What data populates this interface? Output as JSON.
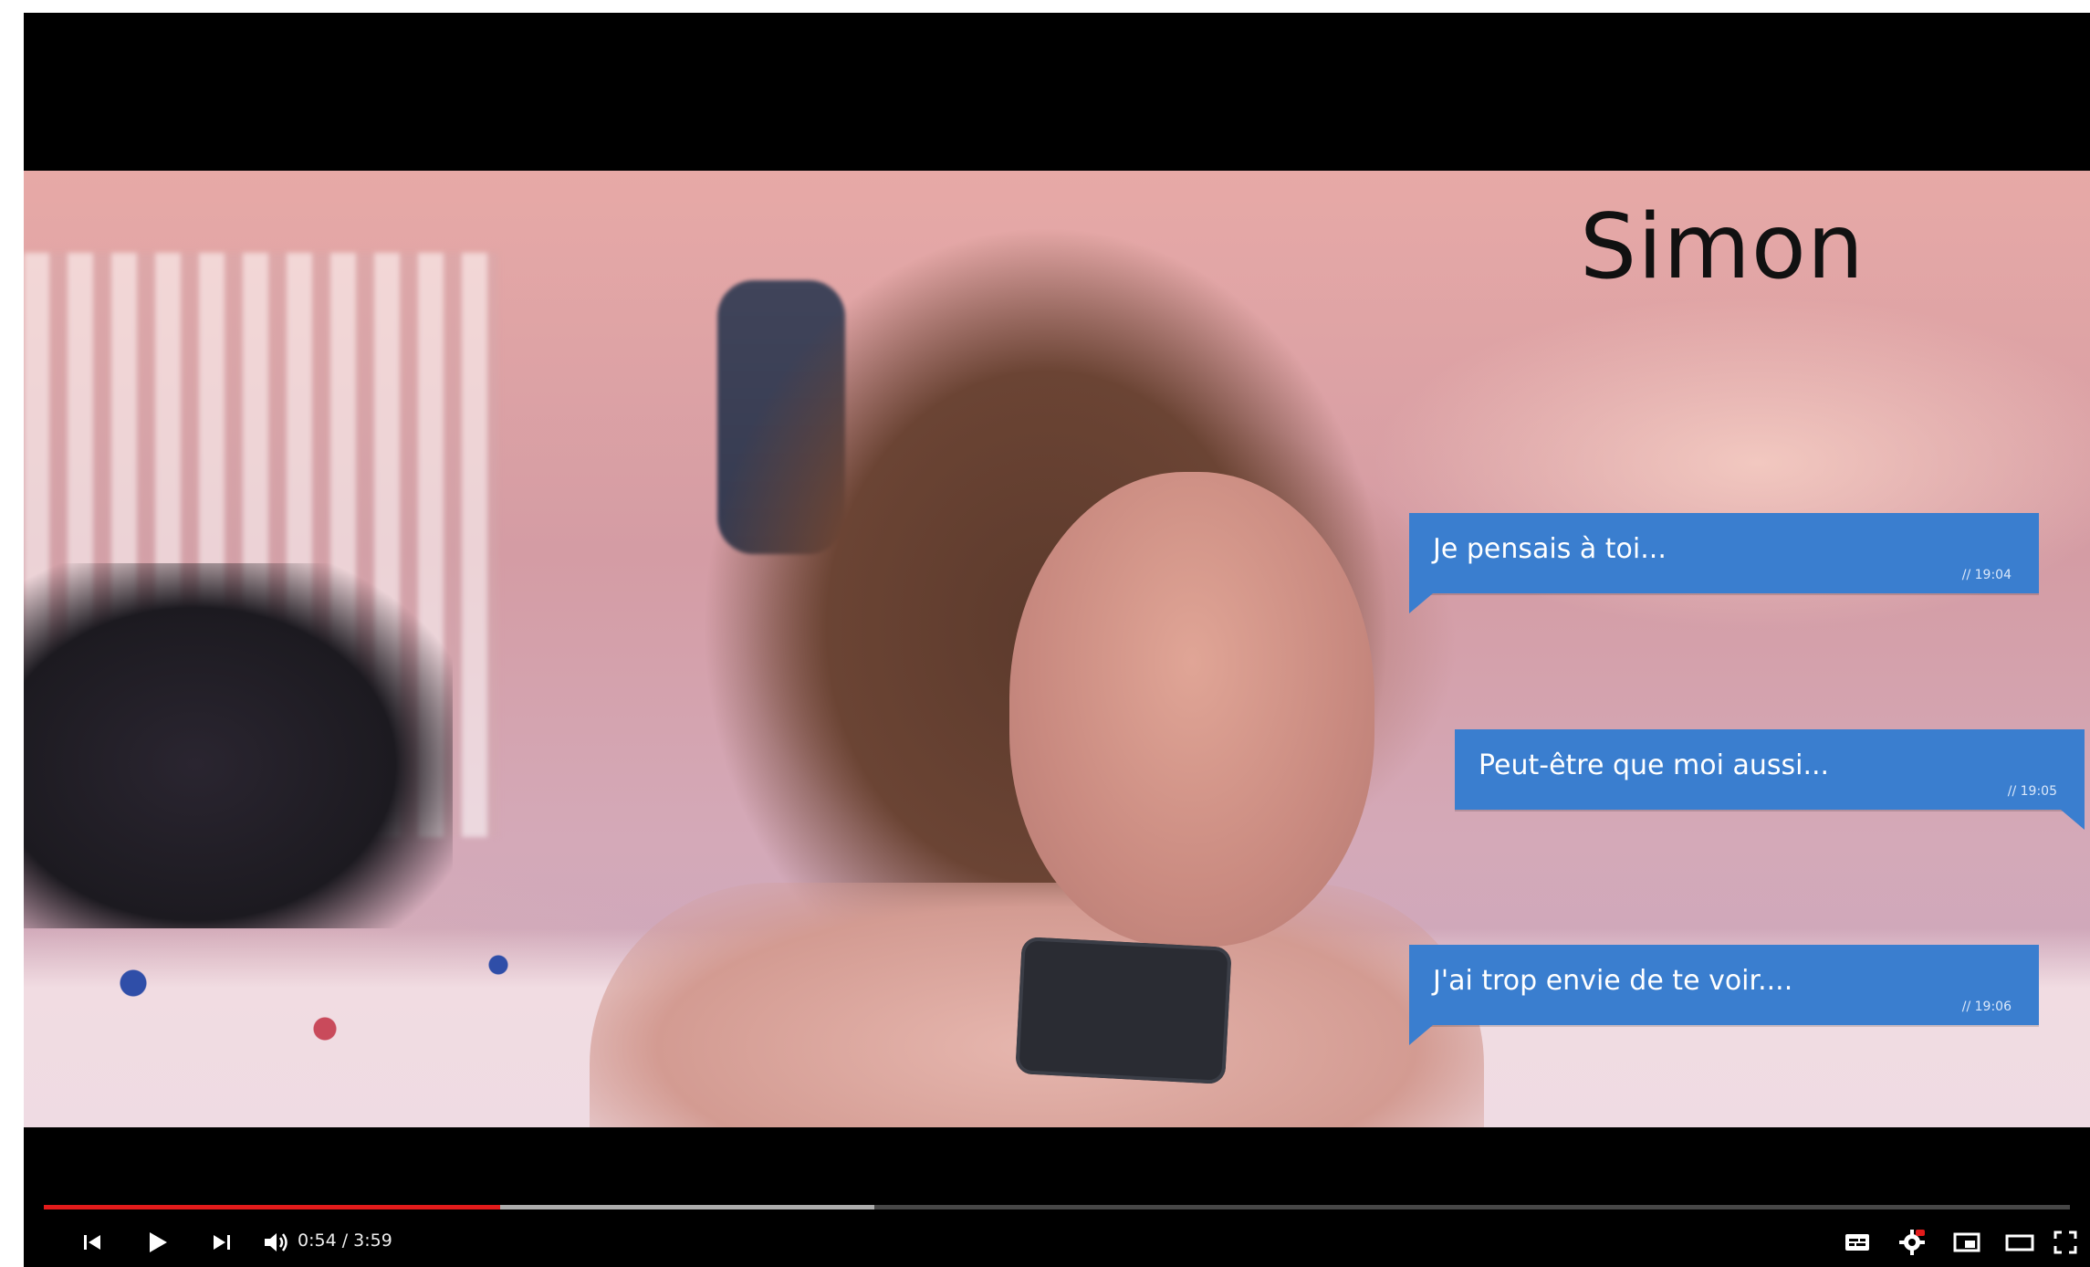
{
  "video": {
    "overlay_title": "Simon",
    "messages": [
      {
        "text": "Je pensais à toi...",
        "time": "// 19:04"
      },
      {
        "text": "Peut-être que moi aussi...",
        "time": "// 19:05"
      },
      {
        "text": "J'ai trop envie de te voir....",
        "time": "// 19:06"
      }
    ],
    "bubble_color": "#3a7ecf"
  },
  "player": {
    "current_time": "0:54",
    "duration": "3:59",
    "time_display": "0:54 / 3:59",
    "progress_played": 0.225,
    "progress_buffered": 0.41,
    "played_color": "#e21b1b",
    "icons": {
      "left": [
        "previous-icon",
        "play-icon",
        "next-icon",
        "volume-icon"
      ],
      "right": [
        "subtitles-icon",
        "settings-icon",
        "miniplayer-icon",
        "theater-icon",
        "fullscreen-icon"
      ]
    }
  }
}
